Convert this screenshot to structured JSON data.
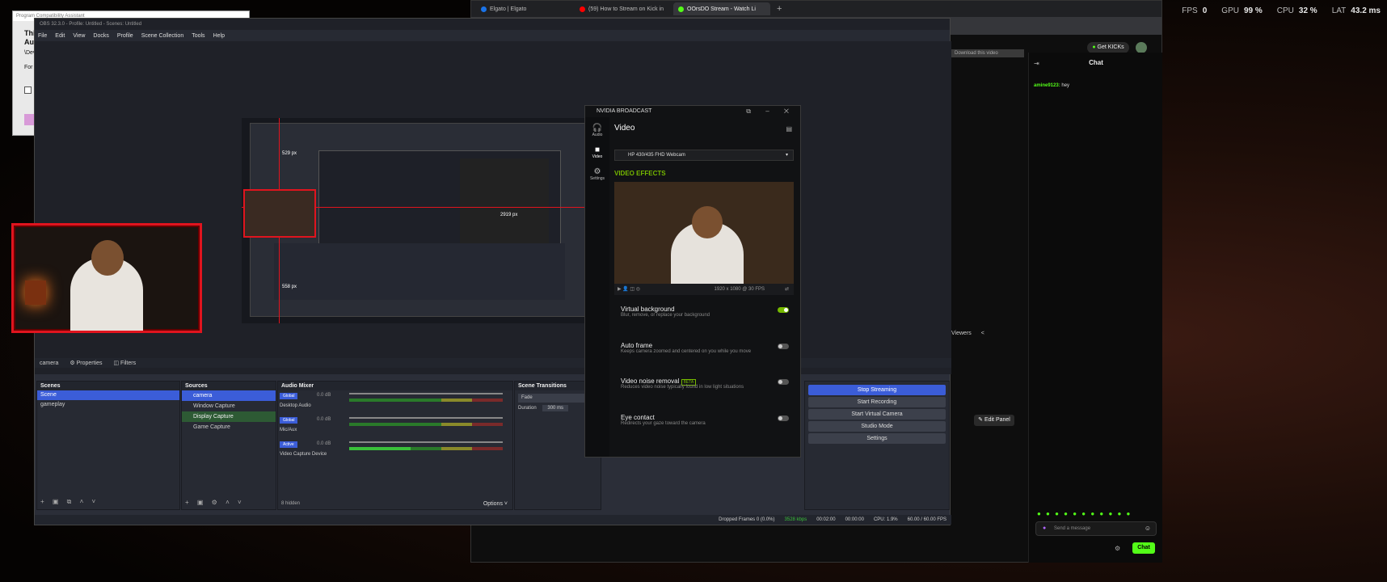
{
  "hud": {
    "fps_label": "FPS",
    "fps": "0",
    "gpu_label": "GPU",
    "gpu": "99 %",
    "cpu_label": "CPU",
    "cpu": "32 %",
    "lat_label": "LAT",
    "lat": "43.2 ms"
  },
  "compat": {
    "title": "Program Compatibility Assistant",
    "frag1": "Thi",
    "frag2": "Aut",
    "frag3": "\\Dev",
    "frag4": "For c"
  },
  "browser": {
    "tabs": [
      {
        "label": "Elgato | Elgato",
        "color": "#1a73e8"
      },
      {
        "label": "(59) How to Stream on Kick in",
        "color": "#ff0000"
      },
      {
        "label": "OOrsDO Stream - Watch Li",
        "color": "#53fc18"
      }
    ],
    "download_hint": "Download this video",
    "get_kicks": "Get KICKs",
    "chat_header": "Chat",
    "chat_msg_user": "amine9123:",
    "chat_msg_text": "hey",
    "viewers_label": "Viewers",
    "edit_panel": "Edit Panel",
    "send_placeholder": "Send a message",
    "chat_button": "Chat"
  },
  "obs": {
    "title": "OBS 32.3.0 - Profile: Untitled - Scenes: Untitled",
    "menu": [
      "File",
      "Edit",
      "View",
      "Docks",
      "Profile",
      "Scene Collection",
      "Tools",
      "Help"
    ],
    "source_bar": {
      "camera": "camera",
      "properties": "Properties",
      "filters": "Filters"
    },
    "scenes": {
      "title": "Scenes",
      "items": [
        "Scene",
        "gameplay"
      ]
    },
    "sources": {
      "title": "Sources",
      "items": [
        "camera",
        "Window Capture",
        "Display Capture",
        "Game Capture"
      ]
    },
    "mixer": {
      "title": "Audio Mixer",
      "channels": [
        {
          "name": "Desktop Audio",
          "db": "0.0 dB",
          "tag": "Global"
        },
        {
          "name": "Mic/Aux",
          "db": "0.0 dB",
          "tag": "Global"
        },
        {
          "name": "Video Capture Device",
          "db": "0.0 dB",
          "tag": "Active"
        }
      ],
      "hidden": "8 hidden",
      "options": "Options"
    },
    "transitions": {
      "title": "Scene Transitions",
      "type": "Fade",
      "duration_label": "Duration",
      "duration": "300 ms"
    },
    "controls": {
      "stop_streaming": "Stop Streaming",
      "start_recording": "Start Recording",
      "start_virtual_camera": "Start Virtual Camera",
      "studio_mode": "Studio Mode",
      "settings": "Settings"
    },
    "status": {
      "dropped": "Dropped Frames 0 (0.0%)",
      "kbps": "3528 kbps",
      "stream_time": "00:02:00",
      "rec_time": "00:00:00",
      "cpu": "CPU: 1.9%",
      "fps": "60.00 / 60.00 FPS"
    },
    "measures": {
      "m1": "529 px",
      "m2": "2919 px",
      "m3": "558 px"
    }
  },
  "nvidia": {
    "title": "NVIDIA BROADCAST",
    "nav": [
      "Audio",
      "Video",
      "Settings"
    ],
    "section": "Video",
    "device": "HP 430/435 FHD Webcam",
    "effects_title": "VIDEO EFFECTS",
    "resolution": "1920 x 1080 @ 30 FPS",
    "effects": [
      {
        "name": "Virtual background",
        "desc": "Blur, remove, or replace your background",
        "on": true,
        "beta": ""
      },
      {
        "name": "Auto frame",
        "desc": "Keeps camera zoomed and centered on you while you move",
        "on": false,
        "beta": ""
      },
      {
        "name": "Video noise removal",
        "desc": "Reduces video noise typically found in low light situations",
        "on": false,
        "beta": "BETA"
      },
      {
        "name": "Eye contact",
        "desc": "Redirects your gaze toward the camera",
        "on": false,
        "beta": ""
      }
    ]
  },
  "colors": {
    "accent_green": "#76b900",
    "kick_green": "#53fc18",
    "obs_blue": "#3b5dd8",
    "frame_red": "#e0141e"
  }
}
